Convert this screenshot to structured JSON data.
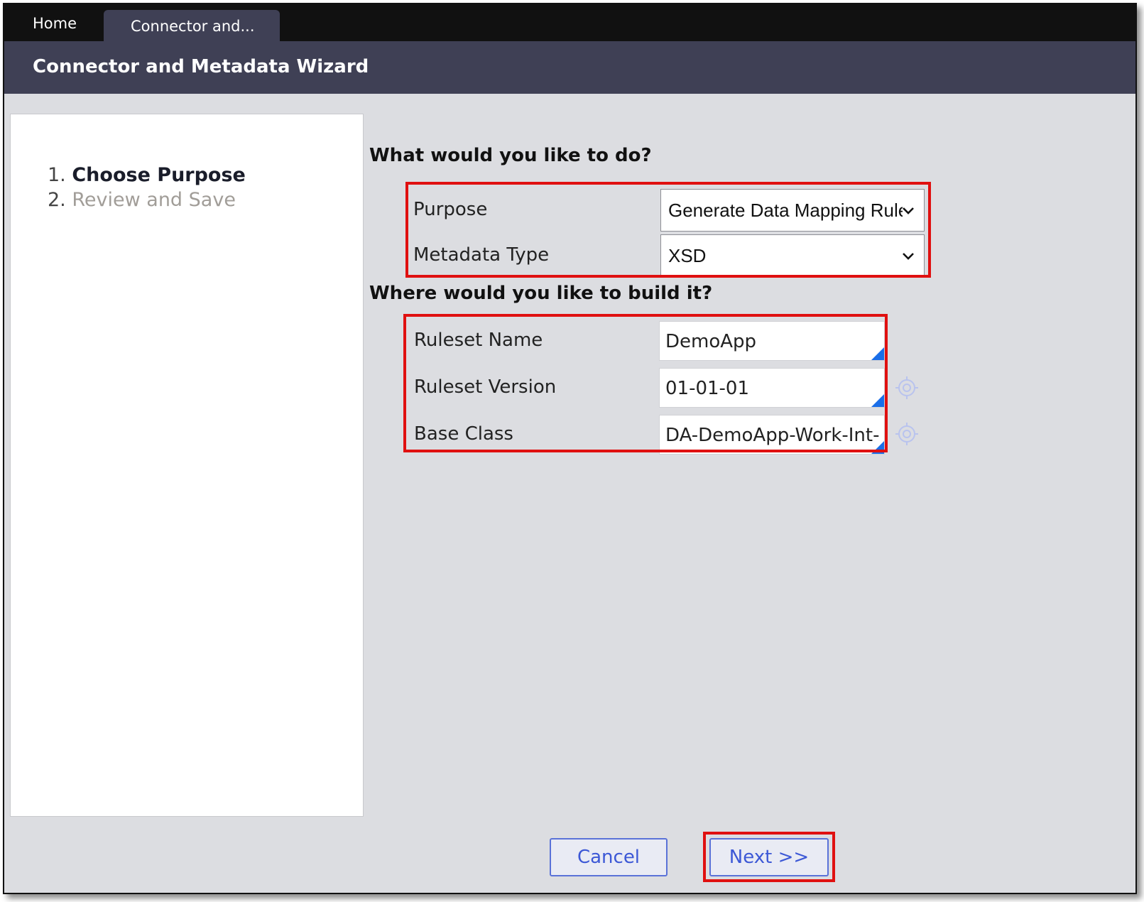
{
  "tabs": [
    {
      "label": "Home"
    },
    {
      "label": "Connector and..."
    }
  ],
  "header": {
    "title": "Connector and Metadata Wizard"
  },
  "steps": [
    {
      "number": "1.",
      "label": "Choose Purpose",
      "state": "active"
    },
    {
      "number": "2.",
      "label": "Review and Save",
      "state": "inactive"
    }
  ],
  "section1": {
    "heading": "What would you like to do?",
    "purpose": {
      "label": "Purpose",
      "value": "Generate Data Mapping Rules"
    },
    "metadata_type": {
      "label": "Metadata Type",
      "value": "XSD"
    }
  },
  "section2": {
    "heading": "Where would you like to build it?",
    "ruleset_name": {
      "label": "Ruleset Name",
      "value": "DemoApp"
    },
    "ruleset_version": {
      "label": "Ruleset Version",
      "value": "01-01-01"
    },
    "base_class": {
      "label": "Base Class",
      "value": "DA-DemoApp-Work-Int-"
    }
  },
  "buttons": {
    "cancel": "Cancel",
    "next": "Next >>"
  },
  "colors": {
    "highlight": "#e01010",
    "header_bg": "#3f4055",
    "tabbar_bg": "#111111",
    "button_text": "#3c58d6"
  },
  "icons": [
    "chevron-down-icon",
    "target-icon",
    "field-corner-marker"
  ]
}
